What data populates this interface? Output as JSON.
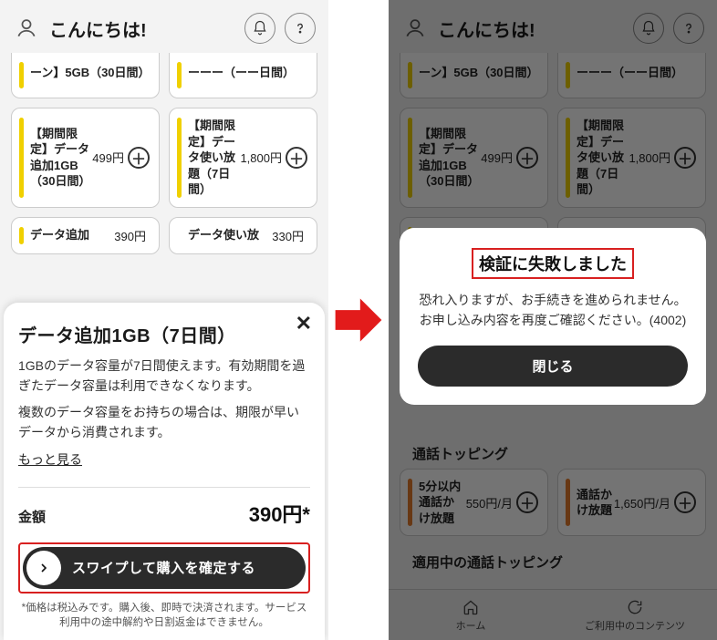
{
  "header": {
    "greeting": "こんにちは!"
  },
  "bg": {
    "row0": {
      "left": {
        "title": "ーン】5GB（30日間）"
      },
      "right": {
        "title": "ーーー（ーー日間）"
      }
    },
    "row1": {
      "left": {
        "title": "【期間限定】データ追加1GB（30日間）",
        "price": "499円"
      },
      "right": {
        "title": "【期間限定】データ使い放題（7日間）",
        "price": "1,800円"
      }
    },
    "row2": {
      "left": {
        "title": "データ追加",
        "price": "390円"
      },
      "right": {
        "title": "データ使い放",
        "price": "330円"
      }
    },
    "call_section": "通話トッピング",
    "call_row": {
      "left": {
        "title": "5分以内通話かけ放題",
        "price": "550円/月"
      },
      "right": {
        "title": "通話かけ放題",
        "price": "1,650円/月"
      }
    },
    "applied_section": "適用中の通話トッピング"
  },
  "sheet": {
    "title": "データ追加1GB（7日間）",
    "desc1": "1GBのデータ容量が7日間使えます。有効期間を過ぎたデータ容量は利用できなくなります。",
    "desc2": "複数のデータ容量をお持ちの場合は、期限が早いデータから消費されます。",
    "more": "もっと見る",
    "amount_label": "金額",
    "amount_value": "390円*",
    "swipe_label": "スワイプして購入を確定する",
    "fineprint": "*価格は税込みです。購入後、即時で決済されます。サービス利用中の途中解約や日割返金はできません。"
  },
  "dialog": {
    "title": "検証に失敗しました",
    "body": "恐れ入りますが、お手続きを進められません。お申し込み内容を再度ご確認ください。(4002)",
    "close": "閉じる"
  },
  "tabbar": {
    "home": "ホーム",
    "contents": "ご利用中のコンテンツ"
  }
}
